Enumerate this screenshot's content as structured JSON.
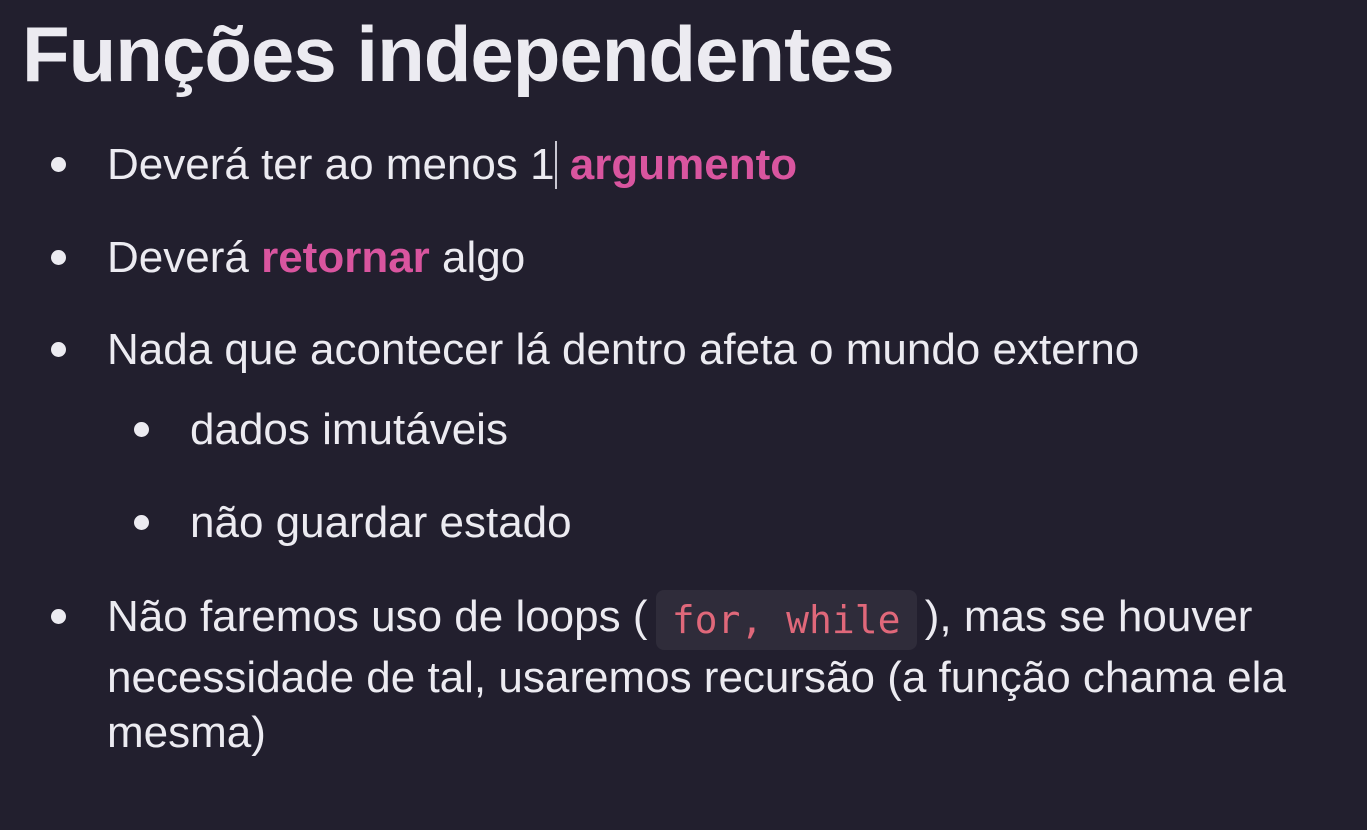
{
  "title": "Funções independentes",
  "bullets": [
    {
      "before": "Deverá ter ao menos 1",
      "highlight": "argumento"
    },
    {
      "before": "Deverá ",
      "highlight": "retornar",
      "after": " algo"
    },
    {
      "text": "Nada que acontecer lá dentro afeta o mundo externo",
      "sub": [
        "dados imutáveis",
        "não guardar estado"
      ]
    },
    {
      "before": "Não faremos uso de loops (",
      "code": "for, while",
      "after": "), mas se houver necessidade de tal, usaremos recursão (a função chama ela mesma)"
    }
  ],
  "colors": {
    "background": "#221f2e",
    "text": "#ecebf1",
    "highlight": "#d9559f",
    "code_text": "#e0687a",
    "code_background": "#2f2c3a"
  }
}
